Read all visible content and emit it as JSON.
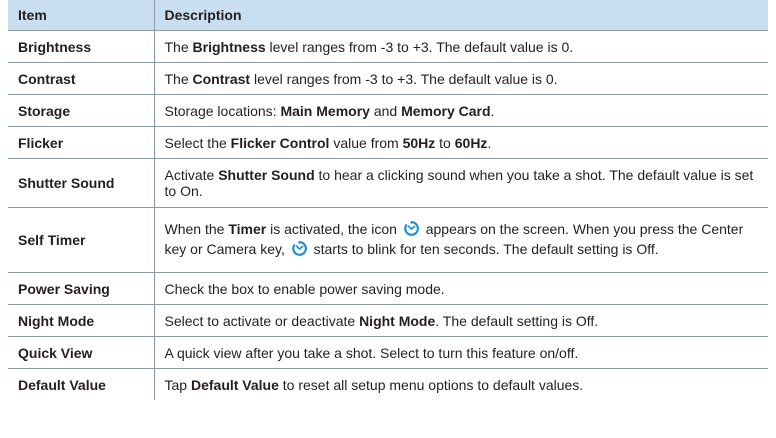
{
  "header": {
    "item": "Item",
    "description": "Description"
  },
  "rows": {
    "brightness": {
      "item": "Brightness",
      "t1": "The ",
      "b1": "Brightness",
      "t2": " level ranges from -3 to +3. The default value is 0."
    },
    "contrast": {
      "item": "Contrast",
      "t1": "The ",
      "b1": "Contrast",
      "t2": " level ranges from -3 to +3. The default value is 0."
    },
    "storage": {
      "item": "Storage",
      "t1": "Storage locations: ",
      "b1": "Main Memory",
      "t2": " and ",
      "b2": "Memory Card",
      "t3": "."
    },
    "flicker": {
      "item": "Flicker",
      "t1": "Select the ",
      "b1": "Flicker Control",
      "t2": " value from ",
      "b2": "50Hz",
      "t3": " to ",
      "b3": "60Hz",
      "t4": "."
    },
    "shutter_sound": {
      "item": "Shutter Sound",
      "t1": "Activate ",
      "b1": "Shutter Sound",
      "t2": " to hear a clicking sound when you take a shot. The default value is set to On."
    },
    "self_timer": {
      "item": "Self Timer",
      "t1": "When the ",
      "b1": "Timer",
      "t2": " is activated, the icon ",
      "t3": " appears on the screen. When you press the Center key or Camera key, ",
      "t4": " starts to blink for ten seconds. The default setting is Off."
    },
    "power_saving": {
      "item": "Power Saving",
      "t1": "Check the box to enable power saving mode."
    },
    "night_mode": {
      "item": "Night Mode",
      "t1": "Select to activate or deactivate ",
      "b1": "Night Mode",
      "t2": ". The default setting is Off."
    },
    "quick_view": {
      "item": "Quick View",
      "t1": "A quick view after you take a shot. Select to turn this feature on/off."
    },
    "default_value": {
      "item": "Default Value",
      "t1": "Tap ",
      "b1": "Default Value",
      "t2": " to reset all setup menu options to default values."
    }
  },
  "colors": {
    "header_bg": "#c9dff1",
    "border": "#8e9aa6",
    "timer_icon": "#1f8fd6"
  },
  "icons": {
    "timer": "self-timer-icon"
  }
}
